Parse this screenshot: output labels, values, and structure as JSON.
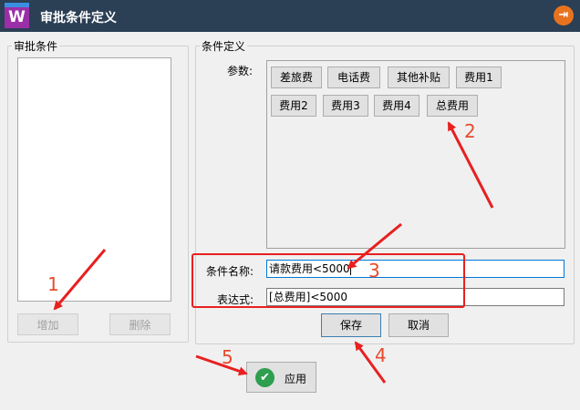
{
  "window": {
    "title": "审批条件定义",
    "logo_letter": "W",
    "exit_glyph": "⇥"
  },
  "left_panel": {
    "legend": "审批条件",
    "add_label": "增加",
    "delete_label": "删除"
  },
  "right_panel": {
    "legend": "条件定义",
    "params_label": "参数:",
    "params": [
      "差旅费",
      "电话费",
      "其他补贴",
      "费用1",
      "费用2",
      "费用3",
      "费用4",
      "总费用"
    ],
    "name_label": "条件名称:",
    "name_value": "请款费用<5000",
    "expr_label": "表达式:",
    "expr_value": "[总费用]<5000",
    "save_label": "保存",
    "cancel_label": "取消"
  },
  "footer": {
    "apply_label": "应用",
    "apply_icon": "check-icon"
  },
  "annotations": {
    "numbers": [
      "1",
      "2",
      "3",
      "4",
      "5"
    ],
    "color": "#e82020"
  },
  "colors": {
    "titlebar": "#2b3f55",
    "logo_top": "#3a8fe0",
    "logo_bottom": "#9b2fa8",
    "exit": "#e8731f",
    "apply_icon": "#2e9e4f"
  }
}
